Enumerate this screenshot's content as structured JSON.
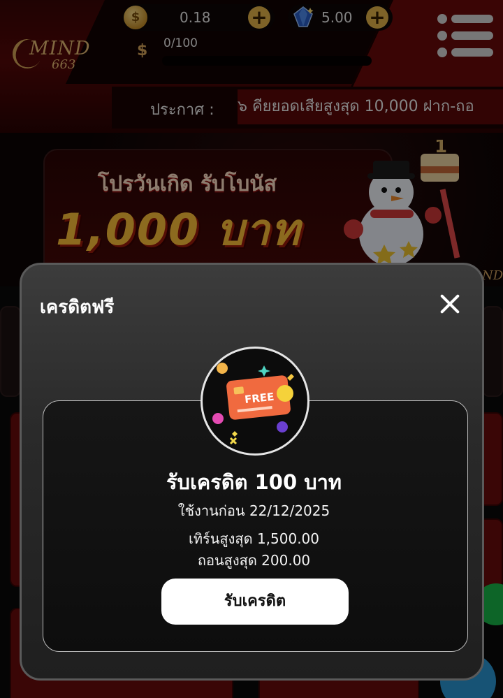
{
  "header": {
    "logo_text": "MIND",
    "logo_number": "663",
    "coin_balance": "0.18",
    "gem_balance": "5.00",
    "xp_text": "0/100",
    "xp_progress": 0,
    "announcement_label": "ประกาศ :",
    "announcement_text": "๖ คียยอดเสียสูงสุด 10,000 ฝาก-ถอ",
    "coin_symbol": "$",
    "plus_symbol": "+"
  },
  "banner": {
    "line1": "โปรวันเกิด รับโบนัส",
    "line2": "1,000 บาท",
    "corner_text": "ND"
  },
  "modal": {
    "title": "เครดิตฟรี",
    "icon_label": "FREE",
    "reward_title": "รับเครดิต 100 บาท",
    "expiry": "ใช้งานก่อน 22/12/2025",
    "max_turnover": "เทิร์นสูงสุด 1,500.00",
    "max_withdraw": "ถอนสูงสุด 200.00",
    "claim_label": "รับเครดิต"
  },
  "colors": {
    "accent_gold": "#e6b54a",
    "header_red": "#560808",
    "modal_bg": "#2a2a2a",
    "claim_bg": "#ffffff"
  }
}
